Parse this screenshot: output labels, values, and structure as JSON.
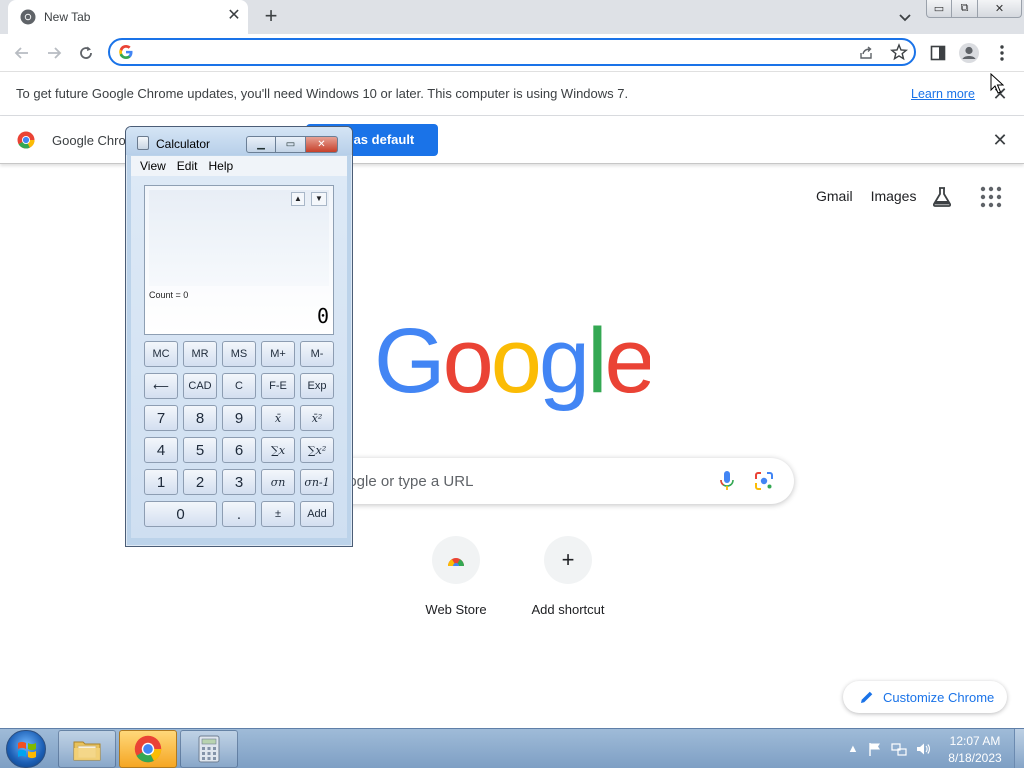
{
  "browser": {
    "tab": {
      "title": "New Tab",
      "close_glyph": "✕"
    },
    "new_tab_glyph": "+",
    "window_controls": {
      "minimize": "▭",
      "restore": "⧉",
      "close": "✕"
    }
  },
  "update_bar": {
    "message": "To get future Google Chrome updates, you'll need Windows 10 or later. This computer is using Windows 7.",
    "link": "Learn more",
    "close_glyph": "✕"
  },
  "default_bar": {
    "message": "Google Chro",
    "button": "Set as default",
    "close_glyph": "✕"
  },
  "ntp": {
    "links": [
      "Gmail",
      "Images"
    ],
    "search_placeholder": "Search Google or type a URL",
    "search_visible_text": "oogle or type a URL",
    "shortcuts": [
      {
        "label": "Web Store",
        "icon": "web-store-icon"
      },
      {
        "label": "Add shortcut",
        "icon": "plus-icon",
        "glyph": "+"
      }
    ],
    "customize_label": "Customize Chrome"
  },
  "calculator": {
    "title": "Calculator",
    "window_controls": {
      "minimize": "▁",
      "maximize": "▭",
      "close": "✕"
    },
    "menu": [
      "View",
      "Edit",
      "Help"
    ],
    "display": {
      "count_text": "Count = 0",
      "value": "0",
      "up": "▲",
      "down": "▼"
    },
    "buttons": {
      "row1": [
        "MC",
        "MR",
        "MS",
        "M+",
        "M-"
      ],
      "row2": [
        "⟵",
        "CAD",
        "C",
        "F-E",
        "Exp"
      ],
      "row3": [
        "7",
        "8",
        "9",
        "x̄",
        "x̄²"
      ],
      "row4": [
        "4",
        "5",
        "6",
        "∑x",
        "∑x²"
      ],
      "row5": [
        "1",
        "2",
        "3",
        "σn",
        "σn-1"
      ],
      "row6": [
        "0",
        ".",
        "±",
        "Add"
      ]
    }
  },
  "taskbar": {
    "tasks": [
      {
        "name": "explorer-task",
        "icon": "folder-icon"
      },
      {
        "name": "chrome-task",
        "icon": "chrome-icon",
        "active": true
      },
      {
        "name": "calculator-task",
        "icon": "calculator-icon"
      }
    ],
    "tray": {
      "arrow": "▲",
      "time": "12:07 AM",
      "date": "8/18/2023"
    }
  },
  "colors": {
    "accent": "#1a73e8",
    "google_blue": "#4285F4",
    "google_red": "#EA4335",
    "google_yellow": "#FBBC05",
    "google_green": "#34A853"
  }
}
